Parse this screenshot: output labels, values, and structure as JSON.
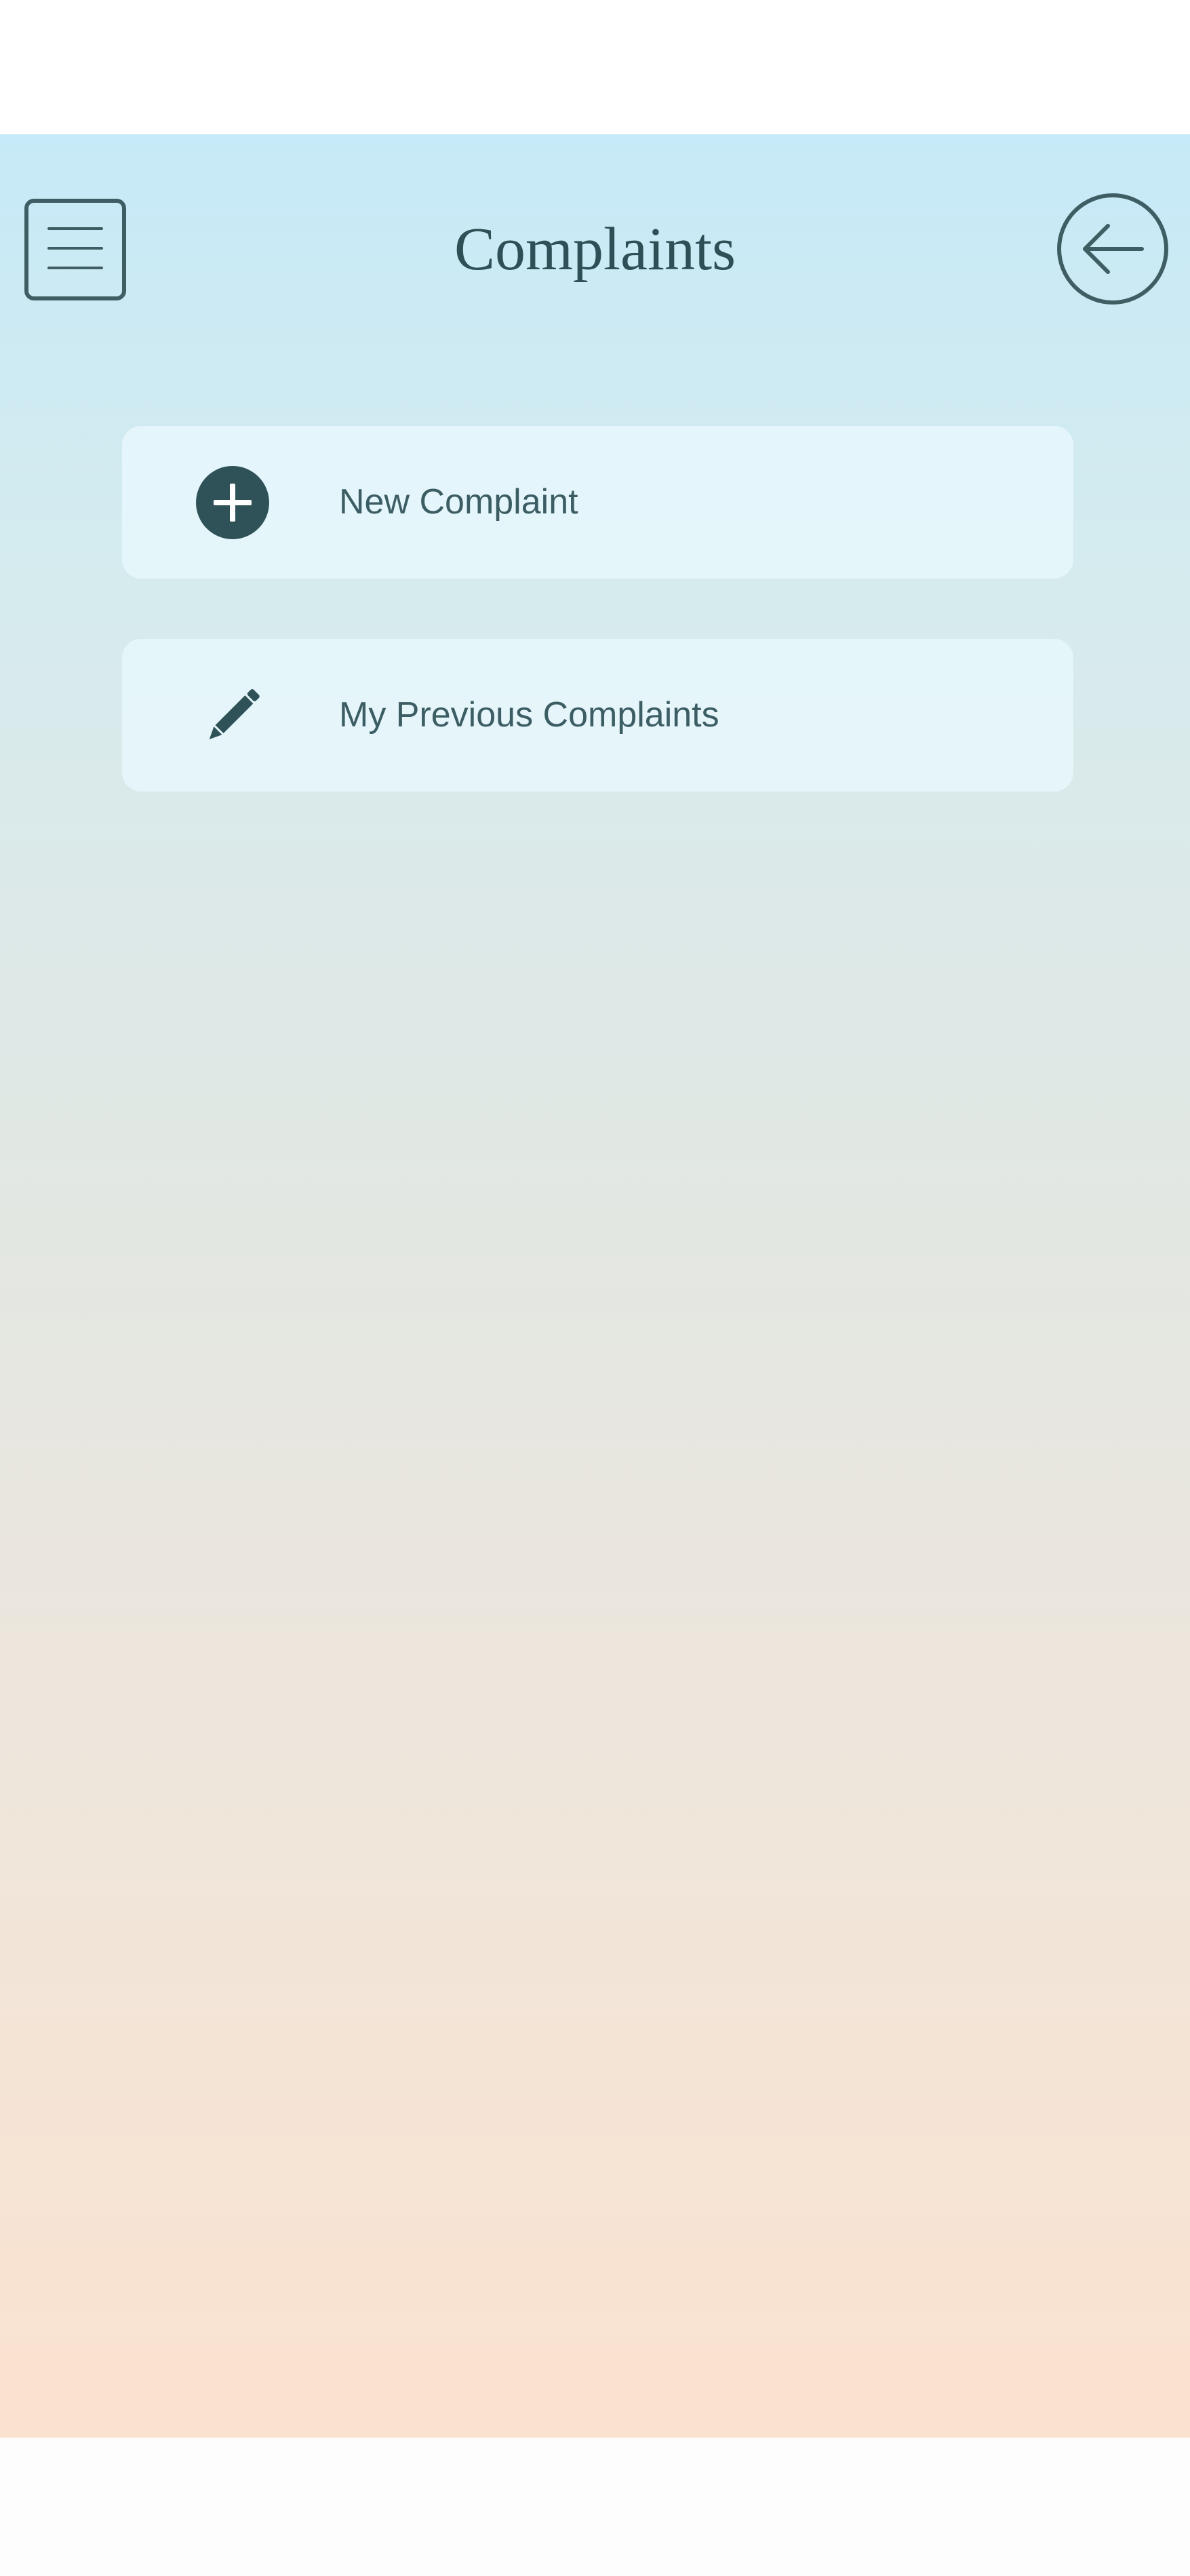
{
  "header": {
    "title": "Complaints",
    "menu_icon": "hamburger-menu-icon",
    "back_icon": "arrow-left-circle-icon"
  },
  "actions": [
    {
      "label": "New Complaint",
      "icon": "plus-circle-icon"
    },
    {
      "label": "My Previous Complaints",
      "icon": "pencil-icon"
    }
  ],
  "colors": {
    "primary_dark": "#2f5258",
    "text": "#3b5d63",
    "gradient_top": "#c6eaf7",
    "gradient_bottom": "#fbe2cf",
    "card_background": "#e3f5fb"
  }
}
